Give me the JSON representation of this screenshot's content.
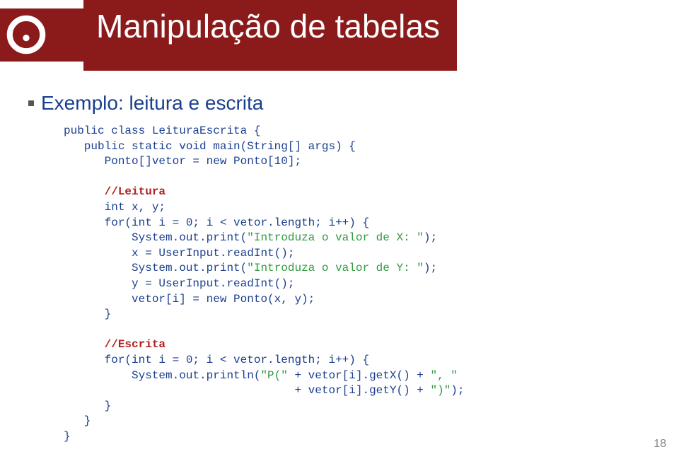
{
  "title": "Manipulação de tabelas",
  "bullet": "Exemplo: leitura e escrita",
  "code": {
    "l1": "public class LeituraEscrita {",
    "l2": "   public static void main(String[] args) {",
    "l3": "      Ponto[]vetor = new Ponto[10];",
    "l4a": "      ",
    "l4b": "//Leitura",
    "l5a": "      int x, y;",
    "l6a": "      for(int i = 0; i < vetor.length; i++) {",
    "l7a": "          System.out.print(",
    "l7b": "\"Introduza o valor de X: \"",
    "l7c": ");",
    "l8a": "          x = UserInput.readInt();",
    "l9a": "          System.out.print(",
    "l9b": "\"Introduza o valor de Y: \"",
    "l9c": ");",
    "l10a": "          y = UserInput.readInt();",
    "l11a": "          vetor[i] = new Ponto(x, y);",
    "l12": "      }",
    "l13a": "      ",
    "l13b": "//Escrita",
    "l14a": "      for(int i = 0; i < vetor.length; i++) {",
    "l15a": "          System.out.println(",
    "l15b": "\"P(\"",
    "l15c": " + vetor[i].getX() + ",
    "l15d": "\", \"",
    "l16a": "                                  + vetor[i].getY() + ",
    "l16b": "\")\"",
    "l16c": ");",
    "l17": "      }",
    "l18": "   }",
    "l19": "}"
  },
  "pageNumber": "18"
}
